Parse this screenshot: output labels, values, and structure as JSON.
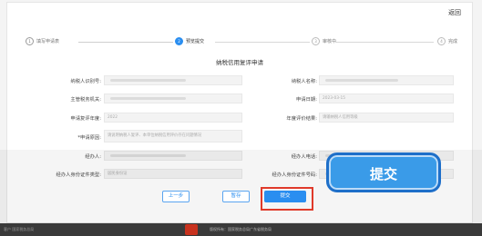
{
  "header": {
    "back_label": "返回"
  },
  "steps": [
    {
      "num": "1",
      "label": "填写申请表"
    },
    {
      "num": "2",
      "label": "预览提交"
    },
    {
      "num": "3",
      "label": "审核中"
    },
    {
      "num": "4",
      "label": "完成"
    }
  ],
  "form": {
    "title": "纳税信用复评申请",
    "fields": {
      "taxpayer_id": {
        "label": "纳税人识别号:",
        "value": ""
      },
      "taxpayer_name": {
        "label": "纳税人名称:",
        "value": ""
      },
      "tax_authority": {
        "label": "主管税务机关:",
        "value": ""
      },
      "apply_date": {
        "label": "申请日期:",
        "value": "2023-03-15"
      },
      "eval_year": {
        "label": "申请复评年度:",
        "value": "2022"
      },
      "eval_result": {
        "label": "年度评价结果:",
        "value": "请输纳税人信用等级"
      },
      "reason": {
        "label": "*申请原因:",
        "value": "请说明纳税人复评、本单位纳税信用评价存在问题情况"
      },
      "agent": {
        "label": "经办人:",
        "value": ""
      },
      "agent_phone": {
        "label": "经办人电话:",
        "value": ""
      },
      "agent_id_type": {
        "label": "经办人身份证件类型:",
        "value": "居民身份证"
      },
      "agent_id_no": {
        "label": "经办人身份证件号码:",
        "value": ""
      }
    }
  },
  "buttons": {
    "prev": "上一步",
    "save": "暂存",
    "submit": "提交"
  },
  "callout": {
    "label": "提交"
  },
  "footer": {
    "text": "版权所有：国家税务总局广东省税务局",
    "left": "客户  国家税务总局"
  },
  "colors": {
    "accent": "#2a8ef0",
    "highlight": "#e03a2a",
    "callout": "#3a9be8"
  }
}
